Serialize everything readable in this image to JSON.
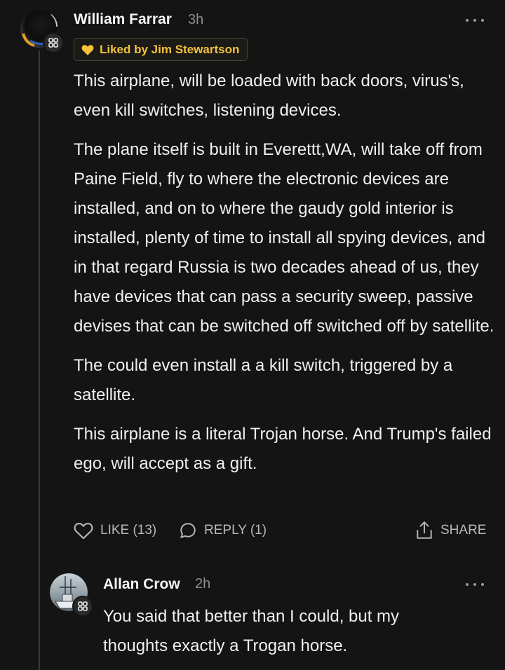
{
  "comment": {
    "author": "William Farrar",
    "time": "3h",
    "liked_by": "Liked by Jim Stewartson",
    "paragraphs": [
      "This airplane, will be loaded with back doors, virus's, even kill switches, listening devices.",
      "The plane itself is built in Everettt,WA, will take off from Paine Field, fly to where the electronic devices are installed, and on to where the gaudy gold interior is installed, plenty of time to install all spying devices, and in that regard Russia is two decades ahead of us, they have devices that can pass a security sweep, passive devises that can be switched off switched off by satellite.",
      "The could even install a a kill switch, triggered by a satellite.",
      "This airplane is a literal Trojan horse. And Trump's failed ego, will accept as a gift."
    ],
    "actions": {
      "like": "LIKE (13)",
      "reply": "REPLY (1)",
      "share": "SHARE"
    }
  },
  "reply": {
    "author": "Allan Crow",
    "time": "2h",
    "text": "You said that better than I could, but my thoughts exactly a Trogan horse."
  },
  "colors": {
    "background": "#141414",
    "liked_accent": "#f4c23c",
    "muted": "#8d8d8d"
  },
  "icons": [
    "subscriber-badge-icon",
    "heart-icon",
    "comment-bubble-icon",
    "share-icon",
    "more-options-icon"
  ]
}
